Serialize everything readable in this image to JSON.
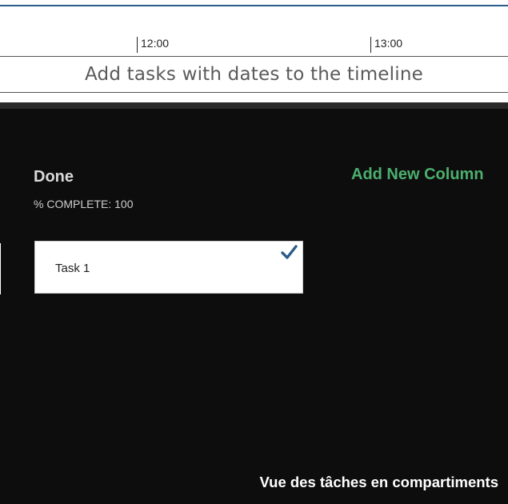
{
  "timeline": {
    "ticks": [
      "12:00",
      "13:00"
    ],
    "hint": "Add tasks with dates to the timeline"
  },
  "board": {
    "column": {
      "title": "Done",
      "subtitle": "% COMPLETE: 100",
      "tasks": [
        {
          "name": "Task 1",
          "status_icon": "checkmark-icon"
        }
      ]
    },
    "add_column_label": "Add New Column"
  },
  "caption": "Vue des tâches en compartiments",
  "colors": {
    "accent_green": "#4caf6e",
    "check_blue": "#2b5c8a",
    "board_background": "#0d0d0d",
    "timeline_background": "#ffffff"
  }
}
